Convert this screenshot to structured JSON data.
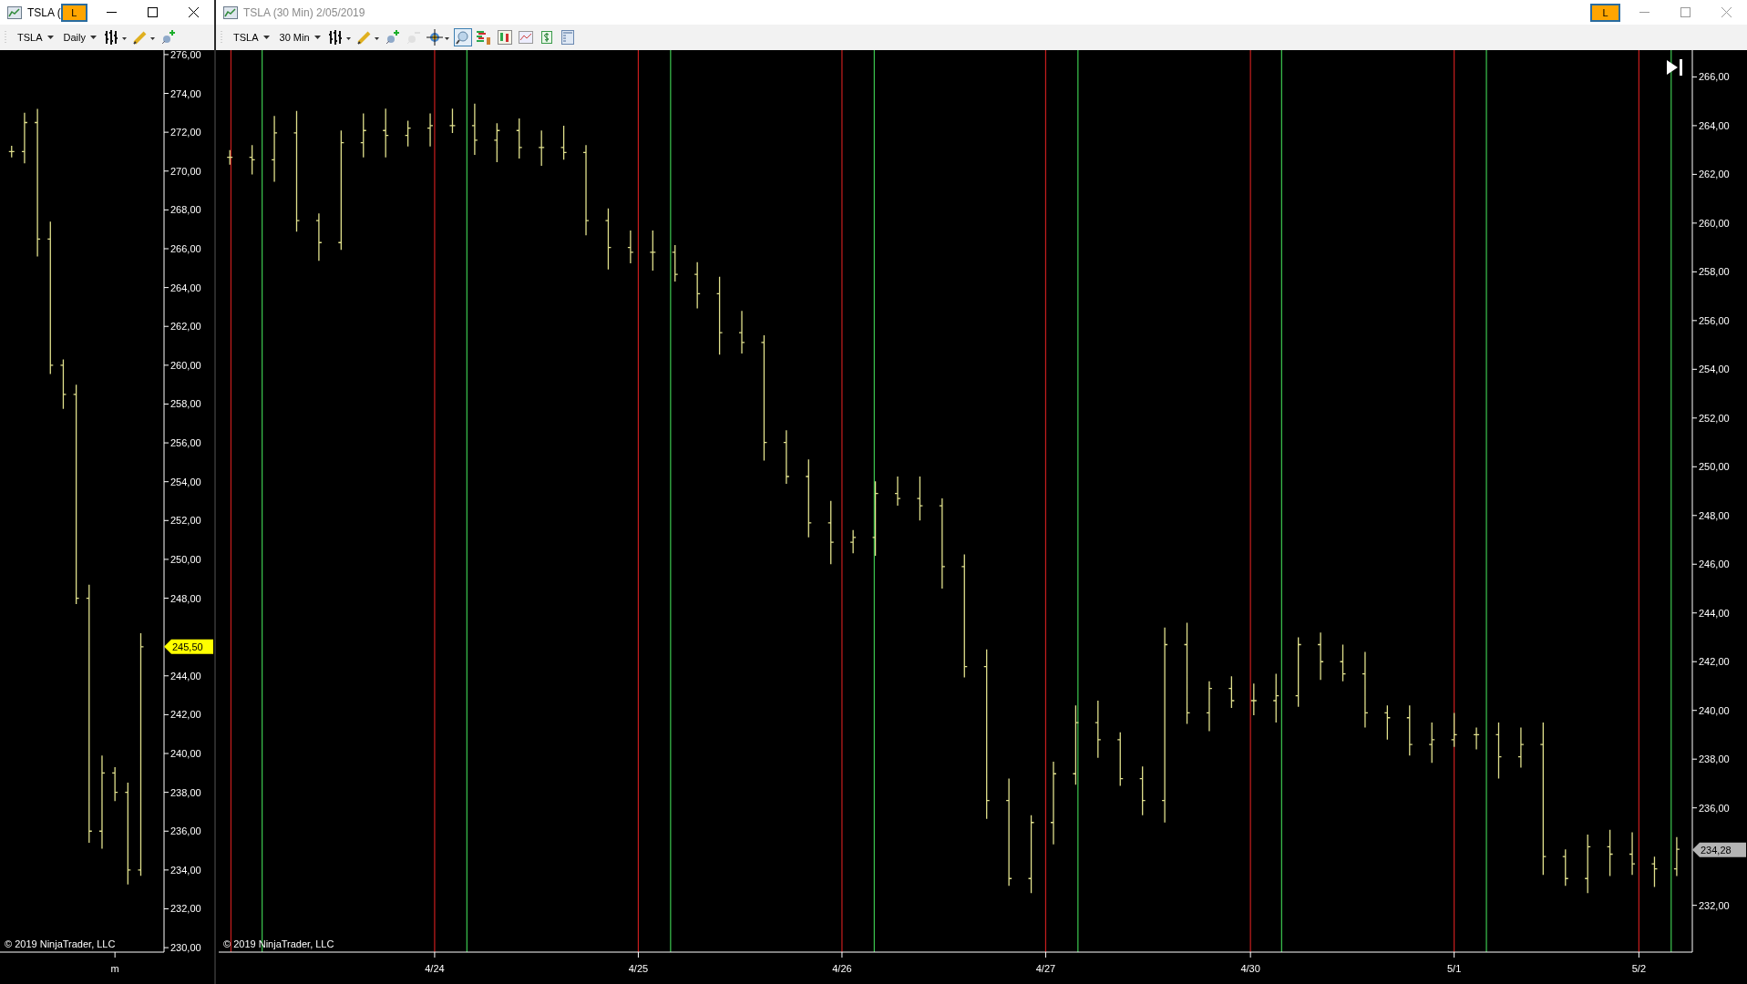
{
  "windows": [
    {
      "title": "TSLA (",
      "active": true,
      "badge": "L",
      "instrument": "TSLA",
      "interval": "Daily",
      "tools": [
        {
          "kind": "bar_style",
          "menu": true,
          "selected": false,
          "disabled": false
        },
        {
          "kind": "drawing",
          "menu": true,
          "selected": false,
          "disabled": false
        },
        {
          "kind": "add_indicator",
          "menu": false,
          "selected": false,
          "disabled": false
        }
      ],
      "copyright": "© 2019 NinjaTrader, LLC",
      "price_axis": [
        "276,00",
        "274,00",
        "272,00",
        "270,00",
        "268,00",
        "266,00",
        "264,00",
        "262,00",
        "260,00",
        "258,00",
        "256,00",
        "254,00",
        "252,00",
        "250,00",
        "248,00",
        "244,00",
        "242,00",
        "240,00",
        "238,00",
        "236,00",
        "234,00",
        "232,00",
        "230,00"
      ],
      "time_axis": [
        "m"
      ],
      "price_marker": {
        "text": "245,50",
        "color": "#ffff00"
      }
    },
    {
      "title": "TSLA (30 Min)  2/05/2019",
      "active": false,
      "badge": "L",
      "instrument": "TSLA",
      "interval": "30 Min",
      "tools": [
        {
          "kind": "bar_style",
          "menu": true,
          "selected": false,
          "disabled": false
        },
        {
          "kind": "drawing",
          "menu": true,
          "selected": false,
          "disabled": false
        },
        {
          "kind": "add_indicator",
          "menu": false,
          "selected": false,
          "disabled": false
        },
        {
          "kind": "remove_indicator",
          "menu": false,
          "selected": false,
          "disabled": true
        },
        {
          "kind": "crosshair",
          "menu": true,
          "selected": false,
          "disabled": false
        },
        {
          "kind": "zoom",
          "menu": false,
          "selected": true,
          "disabled": false
        },
        {
          "kind": "strategy",
          "menu": false,
          "selected": false,
          "disabled": false
        },
        {
          "kind": "chart_trader",
          "menu": false,
          "selected": false,
          "disabled": false
        },
        {
          "kind": "performance",
          "menu": false,
          "selected": false,
          "disabled": false
        },
        {
          "kind": "account",
          "menu": false,
          "selected": false,
          "disabled": false
        },
        {
          "kind": "properties",
          "menu": false,
          "selected": false,
          "disabled": false
        }
      ],
      "overlay_buttons": [
        {
          "kind": "scroll_to_end"
        }
      ],
      "copyright": "© 2019 NinjaTrader, LLC",
      "price_axis": [
        "266,00",
        "264,00",
        "262,00",
        "260,00",
        "258,00",
        "256,00",
        "254,00",
        "252,00",
        "250,00",
        "248,00",
        "246,00",
        "244,00",
        "242,00",
        "240,00",
        "238,00",
        "236,00",
        "232,00"
      ],
      "time_axis": [
        "4/24",
        "4/25",
        "4/26",
        "4/27",
        "4/30",
        "5/1",
        "5/2"
      ],
      "price_marker": {
        "text": "234,28",
        "color": "#b4b4b4"
      }
    }
  ]
}
